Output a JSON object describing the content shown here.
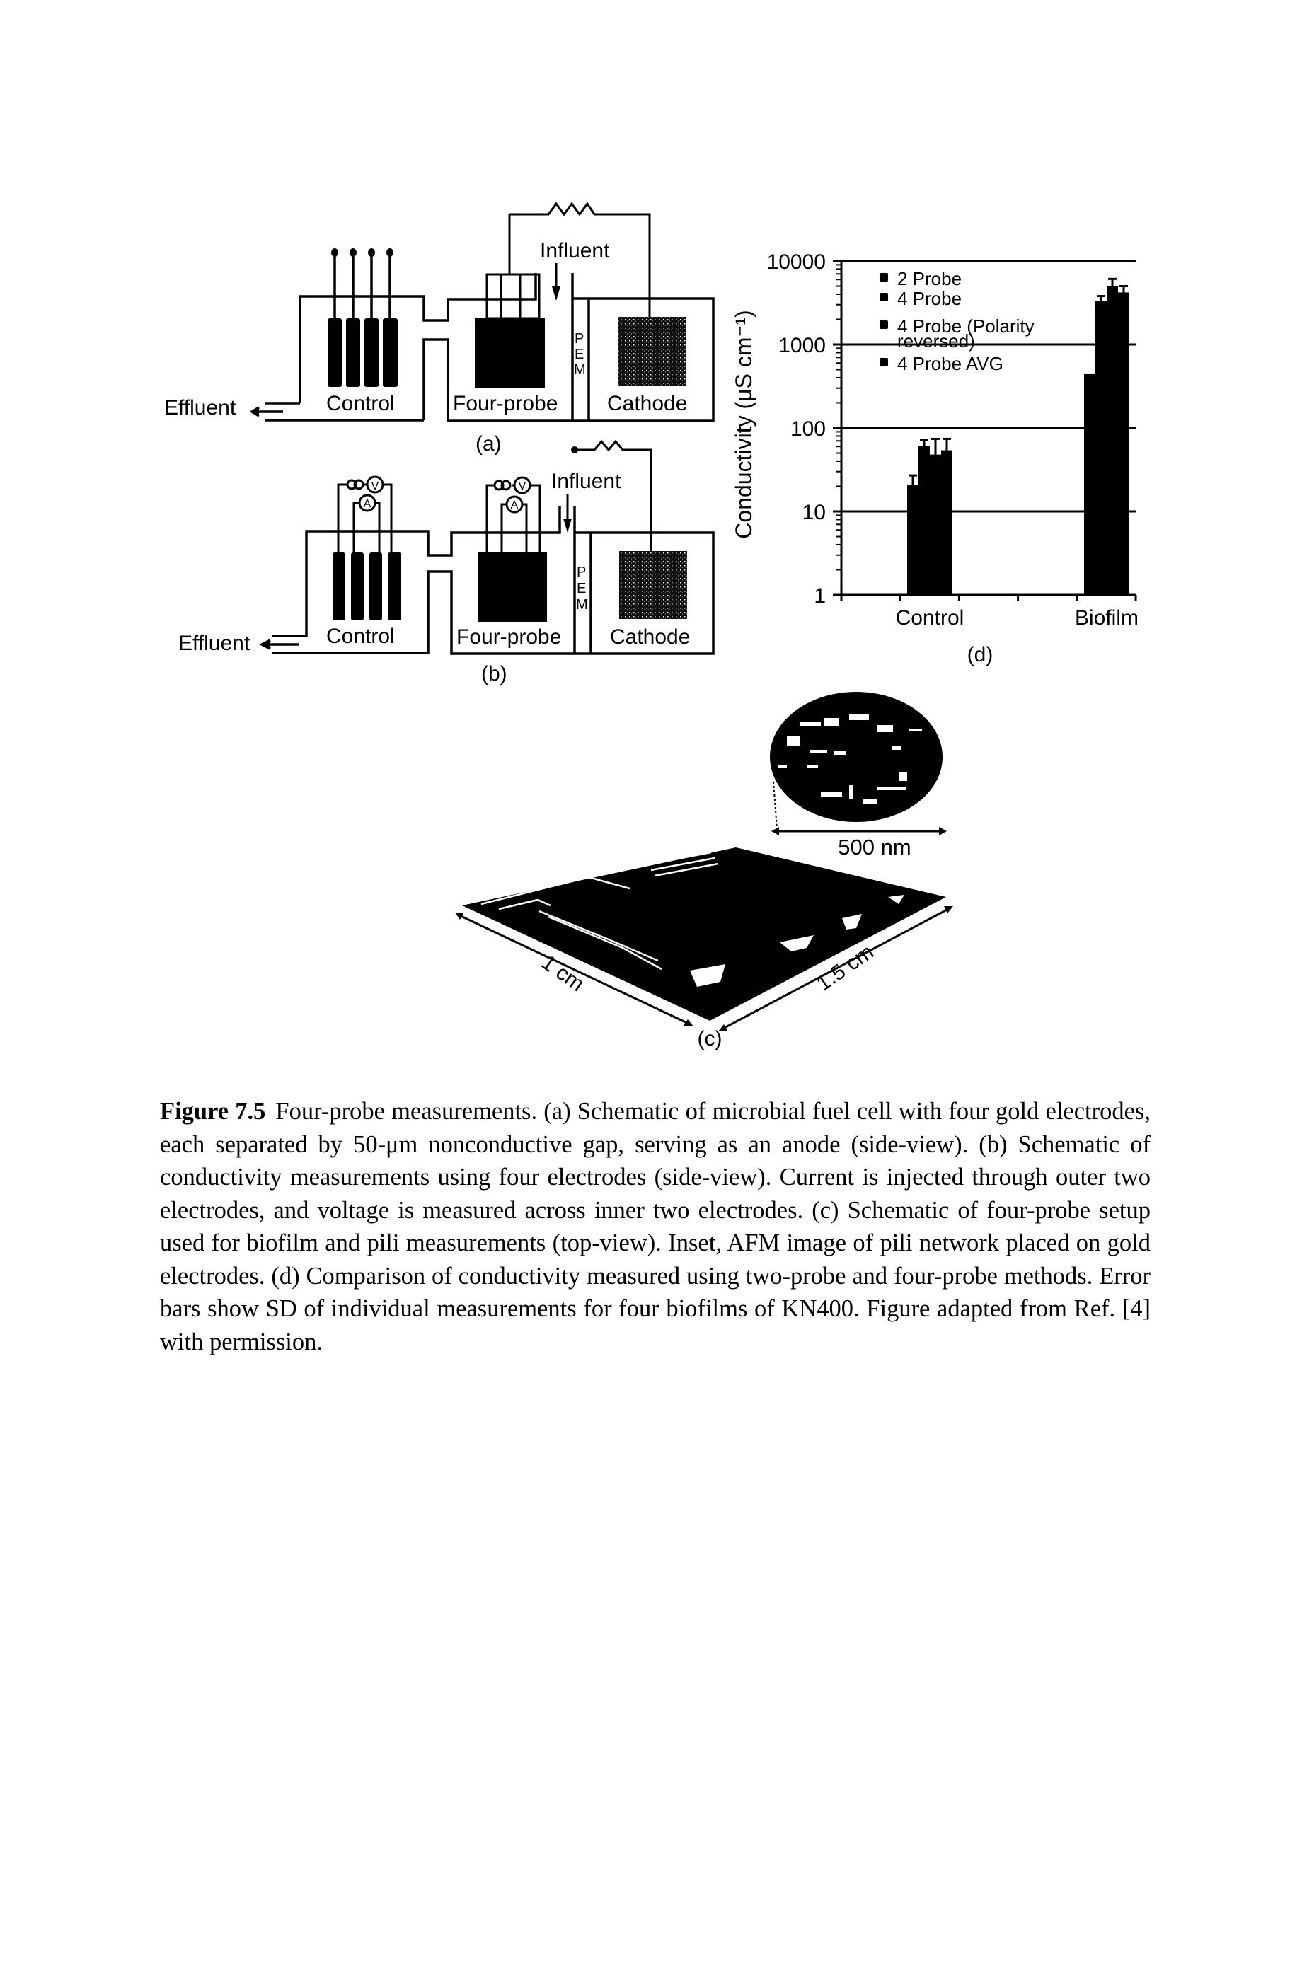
{
  "panel_a": {
    "label": "(a)",
    "effluent": "Effluent",
    "influent": "Influent",
    "control": "Control",
    "four_probe": "Four-probe",
    "cathode": "Cathode",
    "pem": [
      "P",
      "E",
      "M"
    ]
  },
  "panel_b": {
    "label": "(b)",
    "effluent": "Effluent",
    "influent": "Influent",
    "control": "Control",
    "four_probe": "Four-probe",
    "cathode": "Cathode",
    "pem": [
      "P",
      "E",
      "M"
    ],
    "voltmeter": "V",
    "ammeter": "A"
  },
  "panel_c": {
    "label": "(c)",
    "scale_bar": "500 nm",
    "dim_width": "1 cm",
    "dim_length": "1.5 cm"
  },
  "panel_d": {
    "label": "(d)"
  },
  "chart_data": {
    "type": "bar",
    "title": "",
    "xlabel": "",
    "ylabel": "Conductivity (μS cm⁻¹)",
    "yscale": "log",
    "ylim": [
      1,
      10000
    ],
    "yticks": [
      1,
      10,
      100,
      1000,
      10000
    ],
    "ytick_labels": [
      "1",
      "10",
      "100",
      "1000",
      "10000"
    ],
    "grid": "horizontal at decades",
    "legend_position": "top-left",
    "categories": [
      "Control",
      "Biofilm"
    ],
    "series": [
      {
        "name": "2 Probe",
        "values": [
          21,
          450
        ],
        "error_upper": [
          27,
          null
        ]
      },
      {
        "name": "4 Probe",
        "values": [
          61,
          3300
        ],
        "error_upper": [
          72,
          3800
        ]
      },
      {
        "name": "4 Probe (Polarity reversed)",
        "values": [
          48,
          5000
        ],
        "error_upper": [
          74,
          6100
        ]
      },
      {
        "name": "4 Probe AVG",
        "values": [
          54,
          4200
        ],
        "error_upper": [
          74,
          5000
        ]
      }
    ],
    "legend": [
      "2 Probe",
      "4 Probe",
      "4 Probe (Polarity",
      "reversed)",
      "4 Probe AVG"
    ]
  },
  "caption": {
    "label": "Figure 7.5",
    "text": "Four-probe measurements. (a) Schematic of microbial fuel cell with four gold electrodes, each separated by 50-μm nonconductive gap, serving as an anode (side-view). (b) Schematic of conductivity measurements using four electrodes (side-view). Current is injected through outer two electrodes, and voltage is measured across inner two electrodes. (c) Schematic of four-probe setup used for biofilm and pili measurements (top-view). Inset, AFM image of pili network placed on gold electrodes. (d) Comparison of conductivity measured using two-probe and four-probe methods. Error bars show SD of individual measurements for four biofilms of KN400. Figure adapted from Ref. [4] with permission."
  }
}
